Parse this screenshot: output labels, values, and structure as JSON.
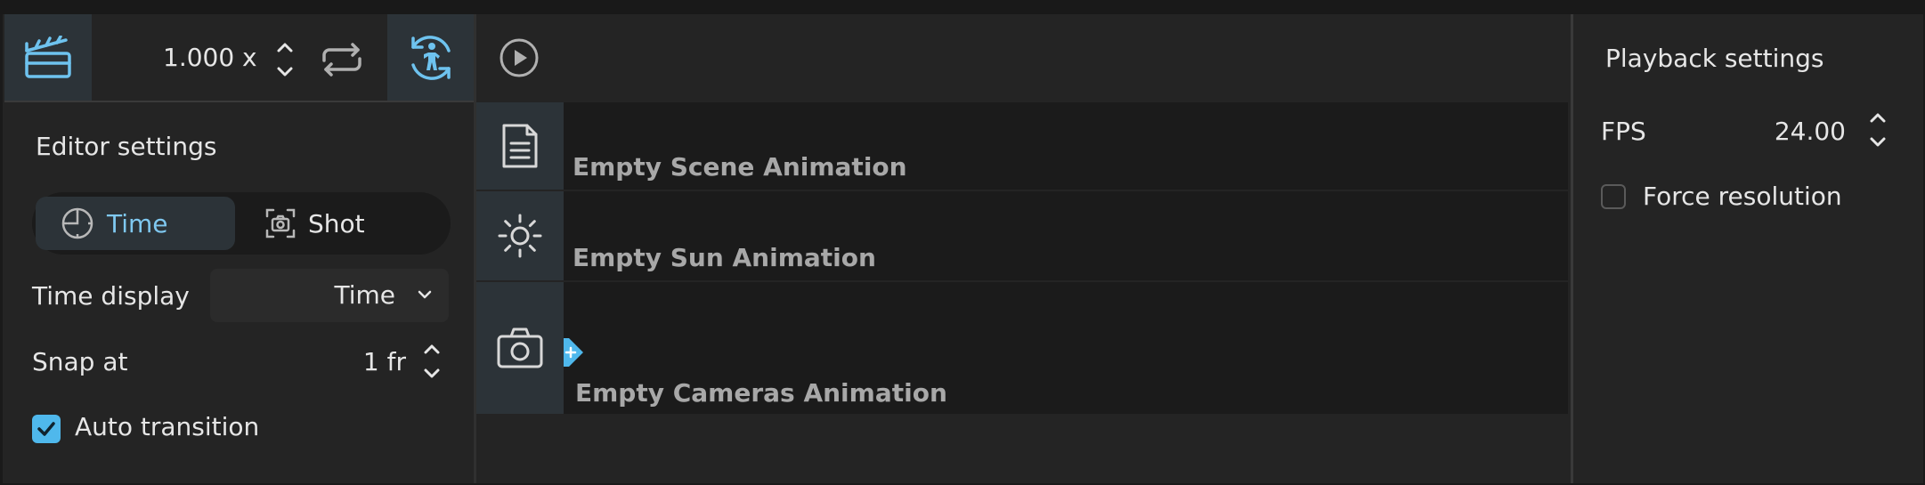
{
  "toolbar": {
    "speed_value": "1.000 x"
  },
  "editor_settings": {
    "title": "Editor settings",
    "mode_segment": {
      "options": [
        "Time",
        "Shot"
      ],
      "selected": "Time"
    },
    "time_display": {
      "label": "Time display",
      "value": "Time"
    },
    "snap_at": {
      "label": "Snap at",
      "value": "1 fr"
    },
    "auto_transition": {
      "label": "Auto transition",
      "checked": true
    }
  },
  "tracks": [
    {
      "name": "Empty Scene Animation",
      "icon": "document-icon"
    },
    {
      "name": "Empty Sun Animation",
      "icon": "sun-icon"
    },
    {
      "name": "Empty Cameras Animation",
      "icon": "camera-icon"
    }
  ],
  "playback_settings": {
    "title": "Playback settings",
    "fps": {
      "label": "FPS",
      "value": "24.00"
    },
    "force_resolution": {
      "label": "Force resolution",
      "checked": false
    }
  },
  "colors": {
    "accent": "#4fb8ec",
    "accent_text": "#7fc8f0",
    "panel": "#242424",
    "track_bg": "#1b1b1b",
    "icon_cell": "#2c3338"
  }
}
